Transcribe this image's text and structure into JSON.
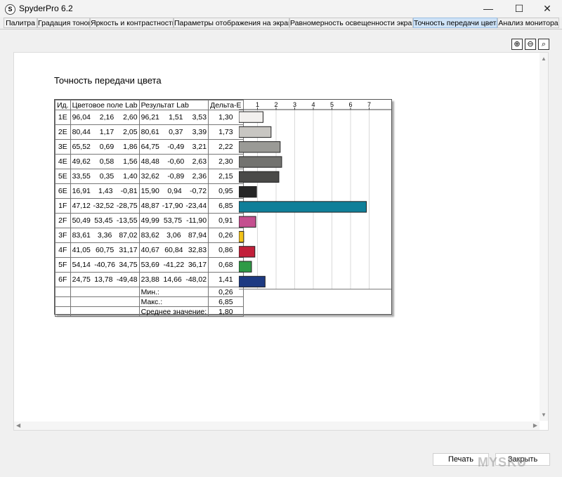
{
  "window": {
    "title": "SpyderPro 6.2",
    "icon_letter": "S"
  },
  "window_controls": {
    "minimize": "—",
    "maximize": "☐",
    "close": "✕"
  },
  "tabs": [
    {
      "label": "Палитра",
      "active": false
    },
    {
      "label": "Градация тонов",
      "active": false
    },
    {
      "label": "Яркость и контрастность",
      "active": false
    },
    {
      "label": "Параметры отображения на экране",
      "active": false
    },
    {
      "label": "Равномерность освещенности экрана",
      "active": false
    },
    {
      "label": "Точность передачи цвета",
      "active": true
    },
    {
      "label": "Анализ монитора",
      "active": false
    }
  ],
  "zoom_tools": [
    {
      "name": "zoom-in-icon",
      "glyph": "⊕"
    },
    {
      "name": "zoom-out-icon",
      "glyph": "⊖"
    },
    {
      "name": "zoom-fit-icon",
      "glyph": "⌕"
    }
  ],
  "report": {
    "title": "Точность передачи цвета",
    "headers": {
      "id": "Ид.",
      "target": "Цветовое поле Lab",
      "result": "Результат Lab",
      "delta": "Дельта-E"
    },
    "rows": [
      {
        "id": "1E",
        "target": [
          "96,04",
          "2,16",
          "2,60"
        ],
        "result": [
          "96,21",
          "1,51",
          "3,53"
        ],
        "delta": "1,30"
      },
      {
        "id": "2E",
        "target": [
          "80,44",
          "1,17",
          "2,05"
        ],
        "result": [
          "80,61",
          "0,37",
          "3,39"
        ],
        "delta": "1,73"
      },
      {
        "id": "3E",
        "target": [
          "65,52",
          "0,69",
          "1,86"
        ],
        "result": [
          "64,75",
          "-0,49",
          "3,21"
        ],
        "delta": "2,22"
      },
      {
        "id": "4E",
        "target": [
          "49,62",
          "0,58",
          "1,56"
        ],
        "result": [
          "48,48",
          "-0,60",
          "2,63"
        ],
        "delta": "2,30"
      },
      {
        "id": "5E",
        "target": [
          "33,55",
          "0,35",
          "1,40"
        ],
        "result": [
          "32,62",
          "-0,89",
          "2,36"
        ],
        "delta": "2,15"
      },
      {
        "id": "6E",
        "target": [
          "16,91",
          "1,43",
          "-0,81"
        ],
        "result": [
          "15,90",
          "0,94",
          "-0,72"
        ],
        "delta": "0,95"
      },
      {
        "id": "1F",
        "target": [
          "47,12",
          "-32,52",
          "-28,75"
        ],
        "result": [
          "48,87",
          "-17,90",
          "-23,44"
        ],
        "delta": "6,85"
      },
      {
        "id": "2F",
        "target": [
          "50,49",
          "53,45",
          "-13,55"
        ],
        "result": [
          "49,99",
          "53,75",
          "-11,90"
        ],
        "delta": "0,91"
      },
      {
        "id": "3F",
        "target": [
          "83,61",
          "3,36",
          "87,02"
        ],
        "result": [
          "83,62",
          "3,06",
          "87,94"
        ],
        "delta": "0,26"
      },
      {
        "id": "4F",
        "target": [
          "41,05",
          "60,75",
          "31,17"
        ],
        "result": [
          "40,67",
          "60,84",
          "32,83"
        ],
        "delta": "0,86"
      },
      {
        "id": "5F",
        "target": [
          "54,14",
          "-40,76",
          "34,75"
        ],
        "result": [
          "53,69",
          "-41,22",
          "36,17"
        ],
        "delta": "0,68"
      },
      {
        "id": "6F",
        "target": [
          "24,75",
          "13,78",
          "-49,48"
        ],
        "result": [
          "23,88",
          "14,66",
          "-48,02"
        ],
        "delta": "1,41"
      }
    ],
    "summary": [
      {
        "label": "Мин.:",
        "value": "0,26"
      },
      {
        "label": "Макс.:",
        "value": "6,85"
      },
      {
        "label": "Среднее значение:",
        "value": "1,80"
      }
    ]
  },
  "chart_data": {
    "type": "bar",
    "orientation": "horizontal",
    "categories": [
      "1E",
      "2E",
      "3E",
      "4E",
      "5E",
      "6E",
      "1F",
      "2F",
      "3F",
      "4F",
      "5F",
      "6F"
    ],
    "values": [
      1.3,
      1.73,
      2.22,
      2.3,
      2.15,
      0.95,
      6.85,
      0.91,
      0.26,
      0.86,
      0.68,
      1.41
    ],
    "bar_colors": [
      "#f2f0ee",
      "#c8c6c2",
      "#9a9a96",
      "#737370",
      "#4a4a48",
      "#262626",
      "#0f7f99",
      "#c44f8f",
      "#f2c219",
      "#c2203a",
      "#2e9a46",
      "#1d3a82"
    ],
    "ticks": [
      1,
      2,
      3,
      4,
      5,
      6,
      7
    ],
    "xlim": [
      0,
      8
    ],
    "grid": true
  },
  "footer": {
    "print_label": "Печать",
    "close_label": "Закрыть",
    "watermark": "MYSKU"
  }
}
